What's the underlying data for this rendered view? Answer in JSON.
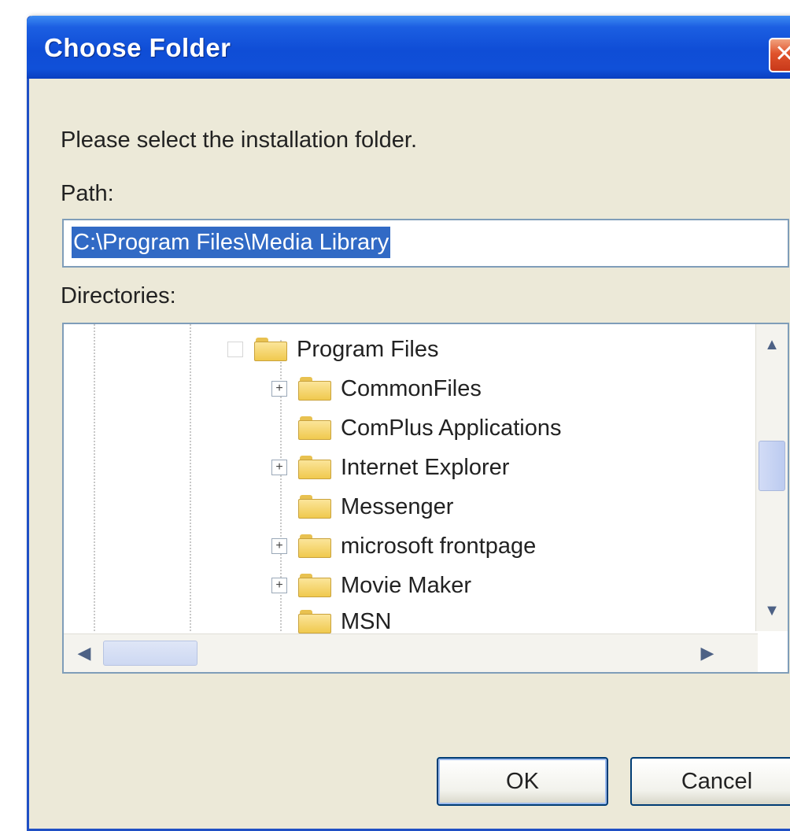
{
  "dialog": {
    "title": "Choose Folder",
    "close_icon": "close-icon",
    "instruction": "Please select the installation folder.",
    "path_label": "Path:",
    "path_value": "C:\\Program Files\\Media Library",
    "directories_label": "Directories:",
    "tree_items": [
      {
        "label": "Program Files",
        "expander": "",
        "icon": "folder-icon"
      },
      {
        "label": "CommonFiles",
        "expander": "+",
        "icon": "folder-icon"
      },
      {
        "label": "ComPlus Applications",
        "expander": "",
        "icon": "folder-icon"
      },
      {
        "label": "Internet Explorer",
        "expander": "+",
        "icon": "folder-icon"
      },
      {
        "label": "Messenger",
        "expander": "",
        "icon": "folder-icon"
      },
      {
        "label": "microsoft frontpage",
        "expander": "+",
        "icon": "folder-icon"
      },
      {
        "label": "Movie Maker",
        "expander": "+",
        "icon": "folder-icon"
      },
      {
        "label": "MSN",
        "expander": "",
        "icon": "folder-icon"
      }
    ],
    "scroll_up_icon": "scroll-up-icon",
    "scroll_down_icon": "scroll-down-icon",
    "scroll_left_icon": "scroll-left-icon",
    "scroll_right_icon": "scroll-right-icon",
    "ok_label": "OK",
    "cancel_label": "Cancel"
  },
  "colors": {
    "titlebar": "#0f4dd6",
    "dialog_bg": "#ece9d8",
    "selection": "#316ac5",
    "folder": "#f0c94e"
  }
}
